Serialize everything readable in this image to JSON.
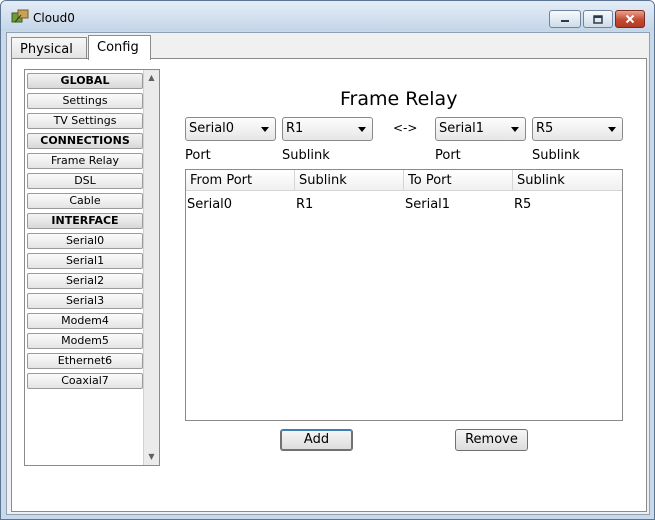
{
  "window": {
    "title": "Cloud0",
    "icon": "cloud-network-icon",
    "controls": {
      "minimize": "minimize-icon",
      "maximize": "maximize-icon",
      "close": "close-icon"
    }
  },
  "tabs": [
    {
      "label": "Physical",
      "active": false
    },
    {
      "label": "Config",
      "active": true
    }
  ],
  "sidebar": {
    "items": [
      {
        "label": "GLOBAL",
        "header": true
      },
      {
        "label": "Settings",
        "header": false
      },
      {
        "label": "TV Settings",
        "header": false
      },
      {
        "label": "CONNECTIONS",
        "header": true
      },
      {
        "label": "Frame Relay",
        "header": false
      },
      {
        "label": "DSL",
        "header": false
      },
      {
        "label": "Cable",
        "header": false
      },
      {
        "label": "INTERFACE",
        "header": true
      },
      {
        "label": "Serial0",
        "header": false
      },
      {
        "label": "Serial1",
        "header": false
      },
      {
        "label": "Serial2",
        "header": false
      },
      {
        "label": "Serial3",
        "header": false
      },
      {
        "label": "Modem4",
        "header": false
      },
      {
        "label": "Modem5",
        "header": false
      },
      {
        "label": "Ethernet6",
        "header": false
      },
      {
        "label": "Coaxial7",
        "header": false
      }
    ]
  },
  "main": {
    "heading": "Frame Relay",
    "from_port": {
      "value": "Serial0",
      "label": "Port"
    },
    "from_sublink": {
      "value": "R1",
      "label": "Sublink"
    },
    "swap_symbol": "<->",
    "to_port": {
      "value": "Serial1",
      "label": "Port"
    },
    "to_sublink": {
      "value": "R5",
      "label": "Sublink"
    },
    "table": {
      "columns": [
        "From Port",
        "Sublink",
        "To Port",
        "Sublink"
      ],
      "rows": [
        [
          "Serial0",
          "R1",
          "Serial1",
          "R5"
        ]
      ]
    },
    "add_label": "Add",
    "remove_label": "Remove"
  },
  "colors": {
    "frame": "#c9d9ea",
    "close_button": "#c54a31",
    "focus_ring": "#3c7fb1"
  }
}
